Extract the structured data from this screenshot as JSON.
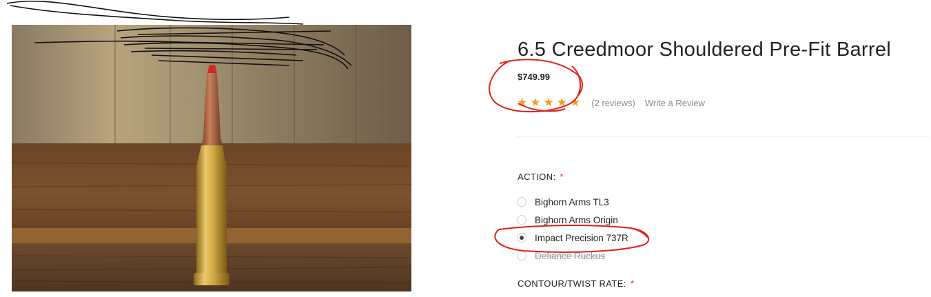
{
  "product": {
    "title": "6.5 Creedmoor Shouldered Pre-Fit Barrel",
    "price": "$749.99",
    "rating": {
      "stars_filled": 5,
      "stars_total": 5,
      "review_count_label": "(2 reviews)",
      "write_review_label": "Write a Review"
    }
  },
  "options": {
    "action": {
      "label": "ACTION:",
      "required_mark": "*",
      "choices": [
        {
          "label": "Bighorn Arms TL3",
          "selected": false,
          "disabled": false
        },
        {
          "label": "Bighorn Arms Origin",
          "selected": false,
          "disabled": false
        },
        {
          "label": "Impact Precision 737R",
          "selected": true,
          "disabled": false
        },
        {
          "label": "Defiance Ruckus",
          "selected": false,
          "disabled": true
        }
      ]
    },
    "contour": {
      "label": "CONTOUR/TWIST RATE:",
      "required_mark": "*"
    }
  },
  "colors": {
    "star": "#f0a020",
    "required": "#d0312d",
    "annotation": "#e0201a"
  },
  "icons": [
    "star-icon",
    "radio-button"
  ]
}
